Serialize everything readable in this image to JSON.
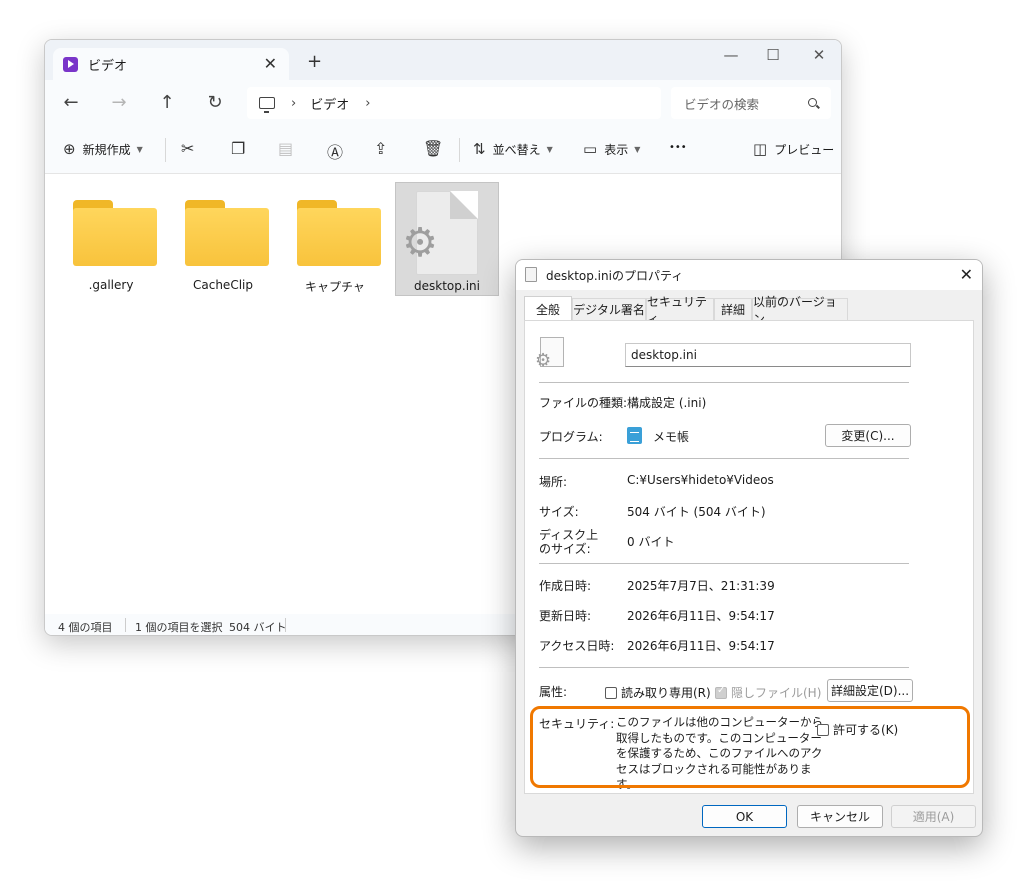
{
  "explorer": {
    "tab_title": "ビデオ",
    "tab_close": "✕",
    "new_tab": "+",
    "window_controls": {
      "minimize": "—",
      "maximize": "☐",
      "close": "✕"
    },
    "nav": {
      "back": "←",
      "forward": "→",
      "up": "↑",
      "refresh": "↻"
    },
    "breadcrumb": {
      "sep1": "›",
      "folder": "ビデオ",
      "sep2": "›"
    },
    "search_placeholder": "ビデオの検索",
    "command_bar": {
      "new_label": "新規作成",
      "sort_label": "並べ替え",
      "view_label": "表示",
      "more": "•••",
      "preview_label": "プレビュー"
    },
    "items": [
      {
        "name": ".gallery",
        "type": "folder"
      },
      {
        "name": "CacheClip",
        "type": "folder"
      },
      {
        "name": "キャプチャ",
        "type": "folder"
      },
      {
        "name": "desktop.ini",
        "type": "file",
        "selected": true
      }
    ],
    "status": {
      "count": "4 個の項目",
      "selection": "1 個の項目を選択",
      "size": "504 バイト"
    }
  },
  "dialog": {
    "title": "desktop.iniのプロパティ",
    "close": "✕",
    "tabs": [
      "全般",
      "デジタル署名",
      "セキュリティ",
      "詳細",
      "以前のバージョン"
    ],
    "active_tab": "全般",
    "filename": "desktop.ini",
    "file_type_label": "ファイルの種類:",
    "file_type_value": "構成設定 (.ini)",
    "program_label": "プログラム:",
    "program_value": "メモ帳",
    "change_button": "変更(C)...",
    "location_label": "場所:",
    "location_value": "C:¥Users¥hideto¥Videos",
    "size_label": "サイズ:",
    "size_value": "504 バイト (504 バイト)",
    "disk_size_label_1": "ディスク上",
    "disk_size_label_2": "のサイズ:",
    "disk_size_value": "0 バイト",
    "created_label": "作成日時:",
    "created_value": "2025年7月7日、21:31:39",
    "modified_label": "更新日時:",
    "modified_value": "2026年6月11日、9:54:17",
    "accessed_label": "アクセス日時:",
    "accessed_value": "2026年6月11日、9:54:17",
    "attributes_label": "属性:",
    "readonly_label": "読み取り専用(R)",
    "hidden_label": "隠しファイル(H)",
    "advanced_button": "詳細設定(D)...",
    "security_label": "セキュリティ:",
    "security_text": "このファイルは他のコンピューターから取得したものです。このコンピューターを保護するため、このファイルへのアクセスはブロックされる可能性があります。",
    "unblock_label": "許可する(K)",
    "ok_button": "OK",
    "cancel_button": "キャンセル",
    "apply_button": "適用(A)"
  },
  "colors": {
    "highlight": "#f07800",
    "accent": "#0067c0",
    "folder": "#f8c33c"
  }
}
